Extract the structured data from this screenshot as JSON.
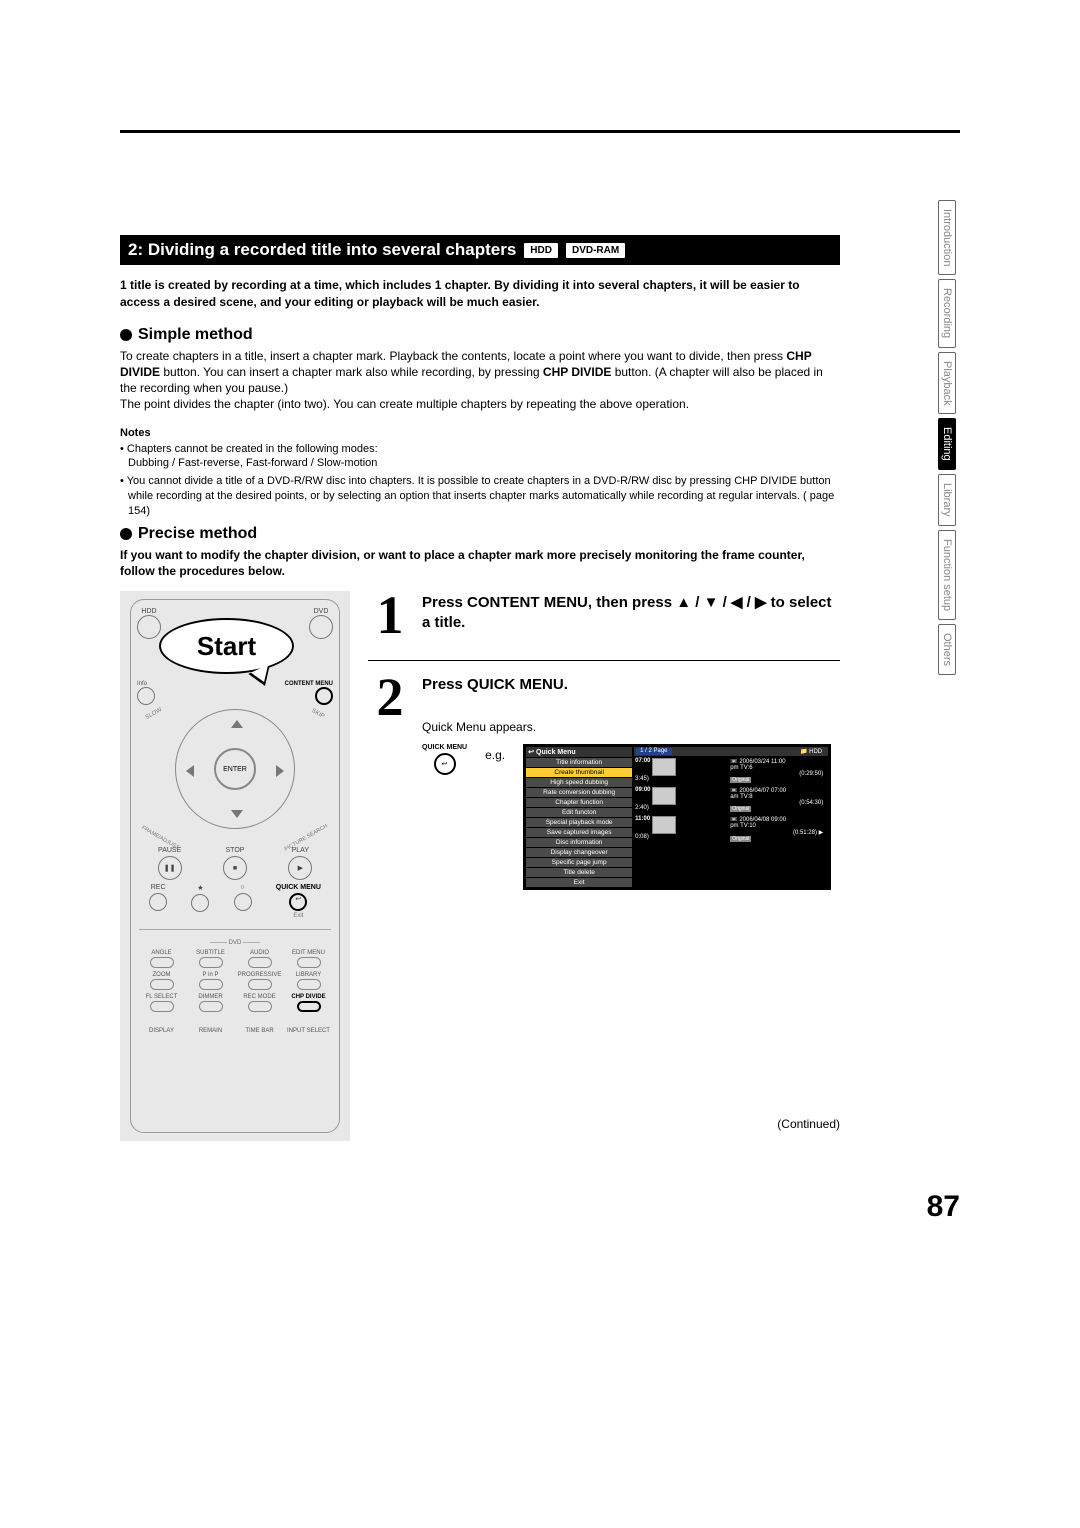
{
  "header": {
    "title": "2: Dividing a recorded title into several chapters",
    "badges": [
      "HDD",
      "DVD-RAM"
    ]
  },
  "intro": "1 title is created by recording at a time, which includes 1 chapter.  By dividing it into several chapters, it will be easier to access a desired scene, and your editing or playback will be much easier.",
  "simple": {
    "heading": "Simple method",
    "body_before": "To create chapters in a title, insert a chapter mark. Playback the contents, locate a point where you want to divide, then press ",
    "b1": "CHP DIVIDE",
    "body_mid": " button. You can insert a chapter mark also while recording, by pressing ",
    "b2": "CHP DIVIDE",
    "body_after": " button. (A chapter will also be placed in the recording when you pause.)",
    "body2": "The point divides the chapter (into two). You can create multiple chapters by repeating the above operation."
  },
  "notes": {
    "heading": "Notes",
    "items": [
      "Chapters cannot be created in the following modes:\nDubbing / Fast-reverse, Fast-forward / Slow-motion",
      "You cannot divide a title of a DVD-R/RW disc into chapters. It is possible to create chapters in a DVD-R/RW disc by pressing CHP DIVIDE button while recording at the desired points, or by selecting an option that inserts chapter marks automatically while recording at regular intervals. (     page 154)"
    ]
  },
  "precise": {
    "heading": "Precise method",
    "body": "If you want to modify the chapter division, or want to place a chapter mark more precisely monitoring the frame counter, follow the procedures below."
  },
  "remote": {
    "start": "Start",
    "hdd": "HDD",
    "dvd": "DVD",
    "info": "Info",
    "content_menu": "CONTENT MENU",
    "enter": "ENTER",
    "slow": "SLOW",
    "skip": "SKIP",
    "frame_adjust": "FRAME/ADJUST",
    "picture_search": "PICTURE SEARCH",
    "pause": "PAUSE",
    "stop": "STOP",
    "play": "PLAY",
    "rec": "REC",
    "star": "★",
    "mark": "○",
    "quick_menu": "QUICK MENU",
    "exit": "Exit",
    "dvd_section": "DVD",
    "bottom_row1": [
      "ANGLE",
      "SUBTITLE",
      "AUDIO",
      "EDIT MENU"
    ],
    "bottom_row2": [
      "ZOOM",
      "P in P",
      "PROGRESSIVE",
      "LIBRARY"
    ],
    "bottom_row3": [
      "FL SELECT",
      "DIMMER",
      "REC MODE",
      "CHP DIVIDE"
    ],
    "bottom_row4": [
      "DISPLAY",
      "REMAIN",
      "TIME BAR",
      "INPUT SELECT"
    ]
  },
  "steps": [
    {
      "num": "1",
      "title": "Press CONTENT MENU, then press ▲ / ▼ / ◀ / ▶ to select a title."
    },
    {
      "num": "2",
      "title": "Press QUICK MENU.",
      "text": "Quick Menu appears.",
      "eg": "e.g.",
      "qm_label": "QUICK MENU"
    }
  ],
  "quick_menu": {
    "title": "Quick Menu",
    "page": "1 / 2  Page",
    "hdd": "HDD",
    "items": [
      "Title information",
      "Create thumbnail",
      "High speed dubbing",
      "Rate conversion dubbing",
      "Chapter function",
      "Edit functon",
      "Special playback mode",
      "Save captured images",
      "Disc information",
      "Display changeover",
      "Specific page jump",
      "Title delete",
      "Exit"
    ],
    "thumbs": [
      {
        "time": "07:00",
        "hidden": "3:45)",
        "date": "2006/03/24 11:00",
        "ch": "pm  TV:6",
        "dur": "(0:29:50)",
        "orig": "Original"
      },
      {
        "time": "09:00",
        "hidden": "2:40)",
        "date": "2006/04/07 07:00",
        "ch": "am  TV:8",
        "dur": "(0:54:30)",
        "orig": "Original"
      },
      {
        "time": "11:00",
        "hidden": "0:08)",
        "date": "2006/04/08 09:00",
        "ch": "pm  TV:10",
        "dur": "(0:51:28) ▶",
        "orig": "Original"
      }
    ]
  },
  "continued": "(Continued)",
  "page_number": "87",
  "tabs": [
    "Introduction",
    "Recording",
    "Playback",
    "Editing",
    "Library",
    "Function setup",
    "Others"
  ],
  "active_tab": "Editing"
}
